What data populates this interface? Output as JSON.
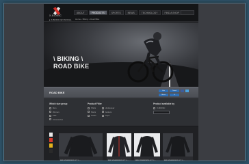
{
  "brand": {
    "name": "X-BIONIC",
    "sub_link": "▸ X-BIONIC EN SOCIAL"
  },
  "nav": {
    "items": [
      "ABOUT",
      "PRODUCTS",
      "SPORTS",
      "NEWS",
      "TECHNOLOGY",
      "FIND A SHOP"
    ],
    "active_index": 1
  },
  "breadcrumb": "Home › Biking › Road Bike",
  "hero": {
    "line1": "\\ BIKING \\",
    "line2": "ROAD BIKE"
  },
  "category": {
    "label": "ROAD BIKE",
    "share_buttons": [
      "Like",
      "Tweet"
    ],
    "share_buttons2": [
      "Share",
      "+1"
    ]
  },
  "filters": {
    "col1": {
      "head": "Which size group",
      "options": [
        "Men",
        "Women",
        "Kids",
        "Accessories"
      ]
    },
    "col2": {
      "head": "Product Filter",
      "options": [
        "Shirts",
        "Pants",
        "Socks",
        "Underwear",
        "Jackets",
        "Caps"
      ]
    },
    "col3": {
      "head": "Product available by",
      "options": [
        "X-BIONIC"
      ]
    }
  },
  "products": [
    {
      "caption": "BIKE SPHEREWIND JKT 1 › ◦"
    },
    {
      "caption": "BIKE SPHEREWIND JKT 1 › ◦"
    },
    {
      "caption": "BIKE SPHEREWIND JKT 1 › ◦"
    },
    {
      "caption": "BIKE SPHEREWIND JKT 1 › ◦"
    }
  ],
  "colors": {
    "accent_red": "#d0302a",
    "swatch": [
      "#e8e8e8",
      "#d83a2c",
      "#e3b21c",
      "#2a2a2a"
    ]
  }
}
